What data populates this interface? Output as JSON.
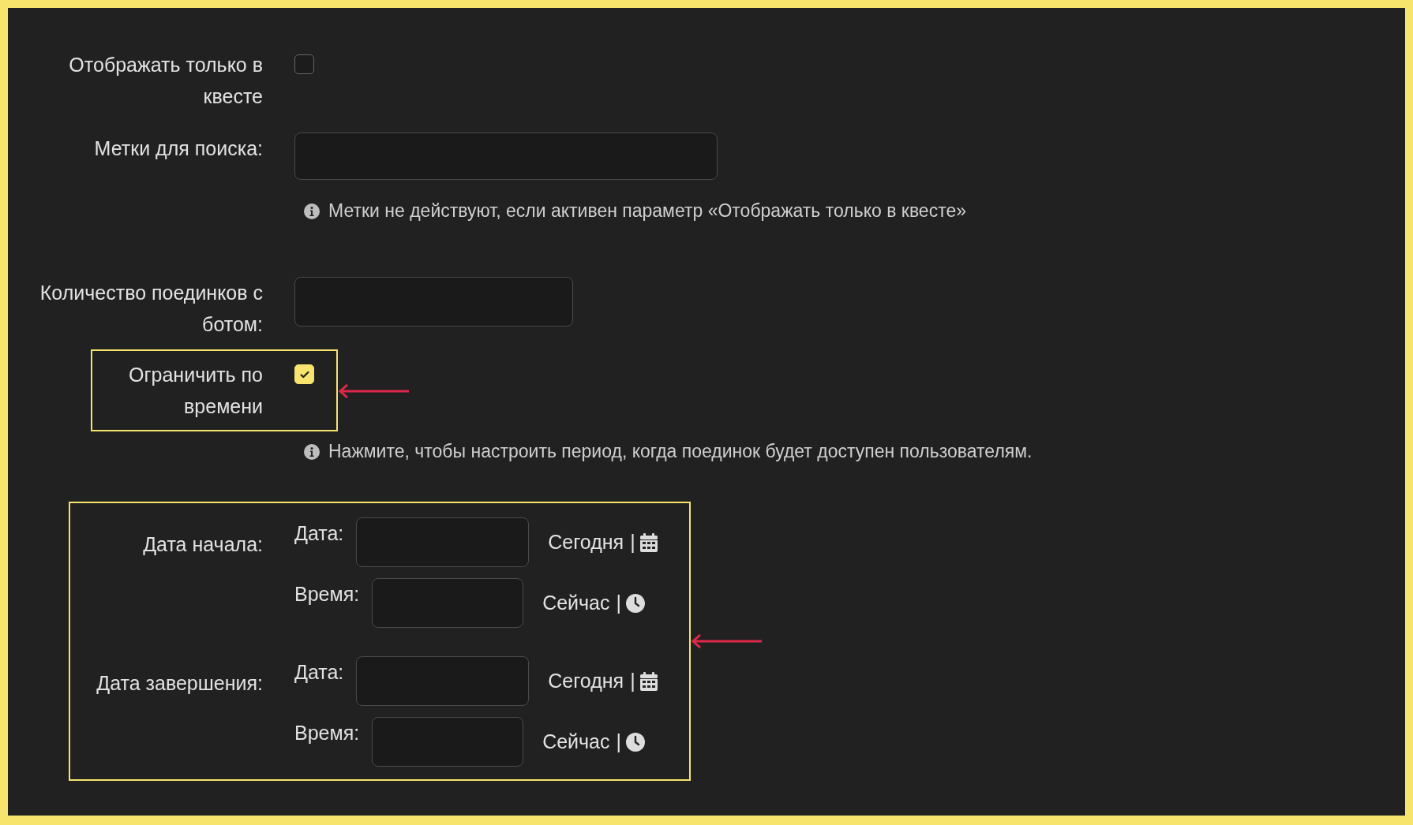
{
  "fields": [
    {
      "kind": "checkbox",
      "label": "Отображать только в квесте",
      "checked": false,
      "highlighted": false
    },
    {
      "kind": "text",
      "label": "Метки для поиска:",
      "hint": "Метки не действуют, если активен параметр «Отображать только в квесте»"
    },
    {
      "kind": "number",
      "label": "Количество поединков с ботом:"
    },
    {
      "kind": "checkbox",
      "label": "Ограничить по времени",
      "checked": true,
      "highlighted": true,
      "hint": "Нажмите, чтобы настроить период, когда поединок будет доступен пользователям."
    }
  ],
  "period": {
    "highlighted": true,
    "groups": [
      {
        "label": "Дата начала:",
        "date_label": "Дата:",
        "today": "Сегодня",
        "date_sep": "|",
        "time_label": "Время:",
        "now": "Сейчас",
        "time_sep": "|"
      },
      {
        "label": "Дата завершения:",
        "date_label": "Дата:",
        "today": "Сегодня",
        "date_sep": "|",
        "time_label": "Время:",
        "now": "Сейчас",
        "time_sep": "|"
      }
    ]
  }
}
